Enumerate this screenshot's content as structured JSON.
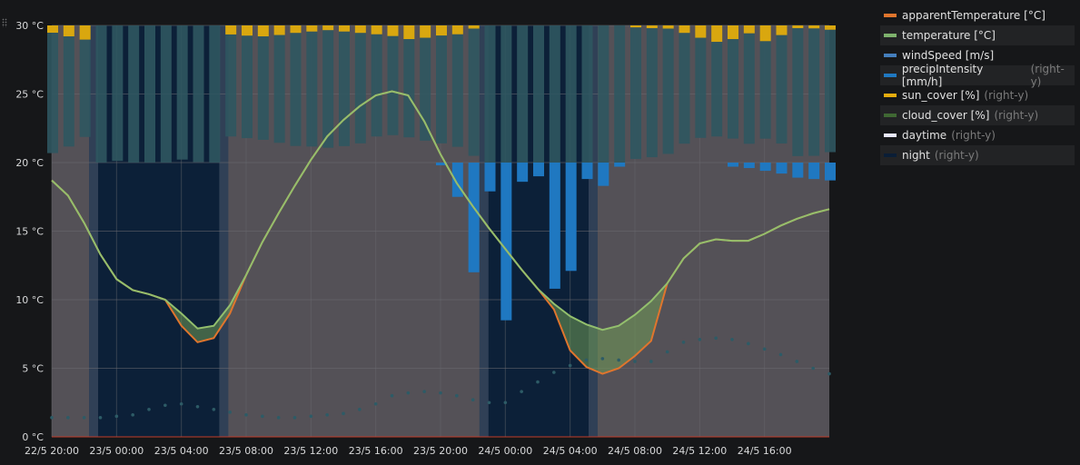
{
  "chart_data": {
    "type": "line",
    "y_left": {
      "min": 0,
      "max": 30,
      "ticks": [
        "0 °C",
        "5 °C",
        "10 °C",
        "15 °C",
        "20 °C",
        "25 °C",
        "30 °C"
      ]
    },
    "x_ticks": [
      "22/5 20:00",
      "23/5 00:00",
      "23/5 04:00",
      "23/5 08:00",
      "23/5 12:00",
      "23/5 16:00",
      "23/5 20:00",
      "24/5 00:00",
      "24/5 04:00",
      "24/5 08:00",
      "24/5 12:00",
      "24/5 16:00"
    ],
    "x_hours": [
      0,
      1,
      2,
      3,
      4,
      5,
      6,
      7,
      8,
      9,
      10,
      11,
      12,
      13,
      14,
      15,
      16,
      17,
      18,
      19,
      20,
      21,
      22,
      23,
      24,
      25,
      26,
      27,
      28,
      29,
      30,
      31,
      32,
      33,
      34,
      35,
      36,
      37,
      38,
      39,
      40,
      41,
      42,
      43,
      44,
      45,
      46,
      47,
      48
    ],
    "night_bands": [
      [
        2.3,
        10.9
      ],
      [
        26.4,
        33.7
      ]
    ],
    "series": [
      {
        "name": "apparentTemperature [°C]",
        "color": "#e0752d",
        "values": [
          18.7,
          17.6,
          15.6,
          13.3,
          11.5,
          10.7,
          10.4,
          10.0,
          8.1,
          6.9,
          7.2,
          9.0,
          11.8,
          14.2,
          16.3,
          18.3,
          20.2,
          21.9,
          23.1,
          24.1,
          24.9,
          25.2,
          24.9,
          23.0,
          20.6,
          18.5,
          16.8,
          15.2,
          13.7,
          12.2,
          10.8,
          9.3,
          6.3,
          5.1,
          4.6,
          5.0,
          5.9,
          7.0,
          11.2,
          13.0,
          14.1,
          14.4,
          14.3,
          14.3,
          14.8,
          15.4,
          15.9,
          16.3,
          16.6
        ]
      },
      {
        "name": "temperature [°C]",
        "color": "#7eb26d",
        "values": [
          18.7,
          17.6,
          15.6,
          13.3,
          11.5,
          10.7,
          10.4,
          10.0,
          9.0,
          7.9,
          8.1,
          9.6,
          11.8,
          14.2,
          16.3,
          18.3,
          20.2,
          21.9,
          23.1,
          24.1,
          24.9,
          25.2,
          24.9,
          23.0,
          20.6,
          18.5,
          16.8,
          15.2,
          13.7,
          12.2,
          10.8,
          9.7,
          8.8,
          8.2,
          7.8,
          8.1,
          8.9,
          9.9,
          11.2,
          13.0,
          14.1,
          14.4,
          14.3,
          14.3,
          14.8,
          15.4,
          15.9,
          16.3,
          16.6
        ]
      },
      {
        "name": "windSpeed [m/s]",
        "color": "#447ebc",
        "values": [
          1.4,
          1.4,
          1.4,
          1.4,
          1.5,
          1.6,
          2.0,
          2.3,
          2.4,
          2.2,
          2.0,
          1.8,
          1.6,
          1.5,
          1.4,
          1.4,
          1.5,
          1.6,
          1.7,
          2.0,
          2.4,
          3.0,
          3.2,
          3.3,
          3.2,
          3.0,
          2.7,
          2.5,
          2.5,
          3.3,
          4.0,
          4.7,
          5.2,
          5.6,
          5.7,
          5.6,
          5.5,
          5.5,
          6.2,
          6.9,
          7.1,
          7.2,
          7.1,
          6.8,
          6.4,
          6.0,
          5.5,
          5.0,
          4.6
        ]
      },
      {
        "name": "precipIntensity [mm/h]",
        "color": "#1f78c1",
        "axis": "right-y",
        "values": [
          0,
          0,
          0,
          0,
          0,
          0,
          0,
          0,
          0,
          0,
          0,
          0,
          0,
          0,
          0,
          0,
          0,
          0,
          0,
          0,
          0,
          0,
          0,
          0,
          0.2,
          2.5,
          8.0,
          2.1,
          11.5,
          1.4,
          1.0,
          9.2,
          7.9,
          1.2,
          1.7,
          0.3,
          0,
          0,
          0,
          0,
          0,
          0,
          0.3,
          0.4,
          0.6,
          0.8,
          1.1,
          1.2,
          1.3
        ]
      },
      {
        "name": "sun_cover [%]",
        "color": "#e5ac0e",
        "axis": "right-y",
        "values": [
          5.3,
          8.0,
          10.4,
          0,
          0,
          0,
          0,
          0,
          0,
          0,
          0,
          6.6,
          7.5,
          8.0,
          7.0,
          5.5,
          4.5,
          3.5,
          4.5,
          5.5,
          6.5,
          7.8,
          10.0,
          9.0,
          7.4,
          6.5,
          2.3,
          0,
          0,
          0,
          0,
          0,
          0,
          0,
          0,
          0,
          1.5,
          2.0,
          2.3,
          5.5,
          9.0,
          12.0,
          10.0,
          5.8,
          11.5,
          7.1,
          2.0,
          2.2,
          3.2
        ]
      },
      {
        "name": "cloud_cover [%]",
        "color": "#3f6833",
        "axis": "right-y",
        "values": [
          93.1,
          88.3,
          81.3,
          100,
          98.8,
          100,
          100,
          100,
          97.8,
          99.7,
          100,
          81.0,
          82.2,
          83.4,
          85.6,
          87.9,
          88.3,
          89.2,
          88.0,
          86.0,
          81.0,
          80.0,
          81.6,
          84.0,
          86.0,
          88.5,
          95.1,
          100,
          100,
          100,
          100,
          100,
          100,
          100,
          100,
          100,
          97.4,
          96.1,
          93.7,
          86.2,
          82.0,
          81.0,
          82.5,
          86.3,
          82.6,
          86.1,
          95.3,
          95.1,
          92.4
        ]
      },
      {
        "name": "daytime",
        "color": "#e8e8ff",
        "axis": "right-y",
        "values": []
      },
      {
        "name": "night",
        "color": "#0a1e36",
        "axis": "right-y",
        "values": []
      }
    ]
  },
  "legend": [
    {
      "label": "apparentTemperature [°C]",
      "axis": "",
      "color": "#e0752d"
    },
    {
      "label": "temperature [°C]",
      "axis": "",
      "color": "#7eb26d"
    },
    {
      "label": "windSpeed [m/s]",
      "axis": "",
      "color": "#447ebc"
    },
    {
      "label": "precipIntensity [mm/h]",
      "axis": "(right-y)",
      "color": "#1f78c1"
    },
    {
      "label": "sun_cover [%]",
      "axis": "(right-y)",
      "color": "#e5ac0e"
    },
    {
      "label": "cloud_cover [%]",
      "axis": "(right-y)",
      "color": "#3f6833"
    },
    {
      "label": "daytime",
      "axis": "(right-y)",
      "color": "#e8e8ff"
    },
    {
      "label": "night",
      "axis": "(right-y)",
      "color": "#0a1e36"
    }
  ],
  "colors": {
    "background": "#161719",
    "day_band": "#545157",
    "night_band": "#0c2038",
    "cloud_bar": "#2f5660",
    "sun_bar": "#d9a70f",
    "precip_bar": "#1f78c1",
    "wind_dot": "#2d5b66",
    "grid": "#6a6a70",
    "axis_text": "#d8d9da"
  }
}
